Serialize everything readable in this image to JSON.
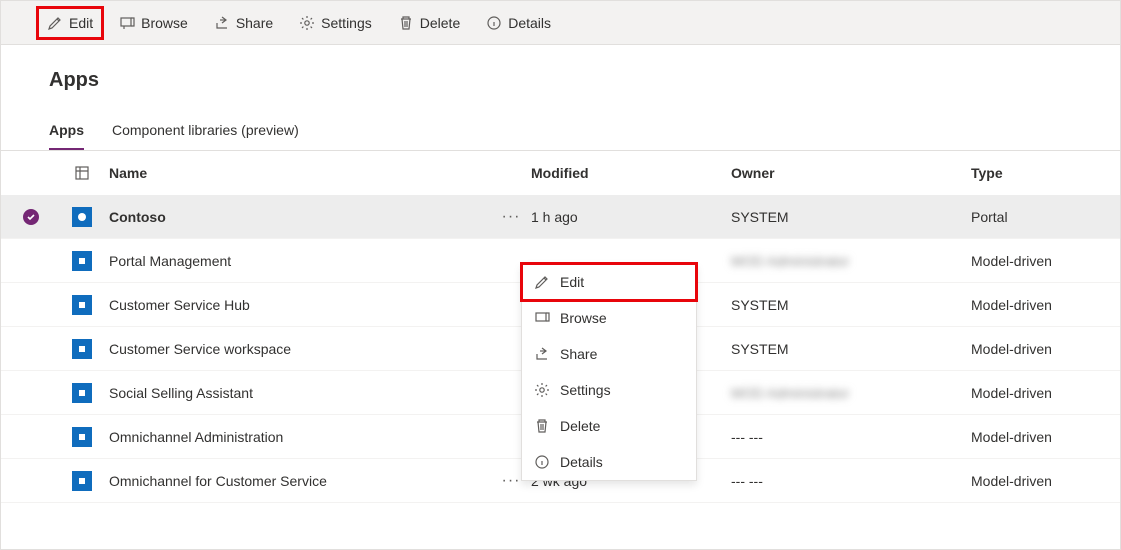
{
  "toolbar": {
    "edit": "Edit",
    "browse": "Browse",
    "share": "Share",
    "settings": "Settings",
    "delete": "Delete",
    "details": "Details"
  },
  "page_title": "Apps",
  "tabs": {
    "apps": "Apps",
    "libs": "Component libraries (preview)"
  },
  "columns": {
    "name": "Name",
    "modified": "Modified",
    "owner": "Owner",
    "type": "Type"
  },
  "rows": [
    {
      "name": "Contoso",
      "modified": "1 h ago",
      "owner": "SYSTEM",
      "type": "Portal",
      "selected": true,
      "owner_blur": false
    },
    {
      "name": "Portal Management",
      "modified": "",
      "owner": "MOD Administrator",
      "type": "Model-driven",
      "selected": false,
      "owner_blur": true
    },
    {
      "name": "Customer Service Hub",
      "modified": "",
      "owner": "SYSTEM",
      "type": "Model-driven",
      "selected": false,
      "owner_blur": false
    },
    {
      "name": "Customer Service workspace",
      "modified": "",
      "owner": "SYSTEM",
      "type": "Model-driven",
      "selected": false,
      "owner_blur": false
    },
    {
      "name": "Social Selling Assistant",
      "modified": "",
      "owner": "MOD Administrator",
      "type": "Model-driven",
      "selected": false,
      "owner_blur": true
    },
    {
      "name": "Omnichannel Administration",
      "modified": "",
      "owner": "--- ---",
      "type": "Model-driven",
      "selected": false,
      "owner_blur": false
    },
    {
      "name": "Omnichannel for Customer Service",
      "modified": "2 wk ago",
      "owner": "--- ---",
      "type": "Model-driven",
      "selected": false,
      "owner_blur": false
    }
  ],
  "ctx": {
    "edit": "Edit",
    "browse": "Browse",
    "share": "Share",
    "settings": "Settings",
    "delete": "Delete",
    "details": "Details"
  },
  "colors": {
    "accent": "#742774",
    "highlight": "#e8050b",
    "app_icon": "#0f6cbd"
  }
}
